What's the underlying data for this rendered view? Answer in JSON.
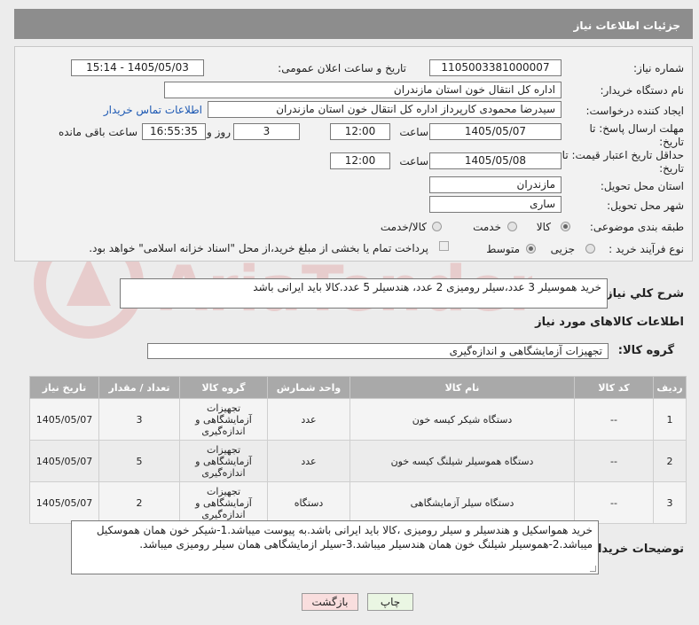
{
  "page": {
    "title": "جزئیات اطلاعات نیاز"
  },
  "form": {
    "need_number_label": "شماره نیاز:",
    "need_number": "1105003381000007",
    "announce_label": "تاریخ و ساعت اعلان عمومی:",
    "announce_value": "1405/05/03 - 15:14",
    "buyer_org_label": "نام دستگاه خریدار:",
    "buyer_org": "اداره کل انتقال خون استان مازندران",
    "creator_label": "ایجاد کننده درخواست:",
    "creator": "سیدرضا محمودی کارپرداز اداره کل انتقال خون استان مازندران",
    "contact_link": "اطلاعات تماس خریدار",
    "send_deadline_label": "مهلت ارسال پاسخ: تا تاریخ:",
    "send_date": "1405/05/07",
    "time_label": "ساعت",
    "send_time": "12:00",
    "days_value": "3",
    "days_label": "روز و",
    "remaining_time": "16:55:35",
    "remaining_label": "ساعت باقی مانده",
    "validity_label": "حداقل تاریخ اعتبار قیمت: تا تاریخ:",
    "validity_date": "1405/05/08",
    "validity_time": "12:00",
    "province_label": "استان محل تحویل:",
    "province": "مازندران",
    "city_label": "شهر محل تحویل:",
    "city": "ساری",
    "category_label": "طبقه بندی موضوعی:",
    "category_options": [
      "کالا",
      "خدمت",
      "کالا/خدمت"
    ],
    "process_label": "نوع فرآیند خرید :",
    "process_options": [
      "جزیی",
      "متوسط"
    ],
    "payment_note": "پرداخت تمام یا بخشی از مبلغ خرید،از محل \"اسناد خزانه اسلامی\" خواهد بود."
  },
  "description": {
    "label": "شرح کلي نياز:",
    "value": "خرید هموسیلر 3 عدد،سیلر رومیزی 2 عدد، هندسیلر 5 عدد.کالا باید ایرانی باشد"
  },
  "goods": {
    "section_title": "اطلاعات کالاهای مورد نیاز",
    "group_label": "گروه کالا:",
    "group_value": "تجهیزات آزمایشگاهی و اندازه‌گیری",
    "columns": [
      "ردیف",
      "کد کالا",
      "نام کالا",
      "واحد شمارش",
      "گروه کالا",
      "تعداد / مقدار",
      "تاریخ نیاز"
    ],
    "rows": [
      {
        "idx": "1",
        "code": "--",
        "name": "دستگاه شیکر کیسه خون",
        "unit": "عدد",
        "group": "تجهیزات آزمایشگاهی و اندازه‌گیری",
        "qty": "3",
        "date": "1405/05/07"
      },
      {
        "idx": "2",
        "code": "--",
        "name": "دستگاه هموسیلر شیلنگ کیسه خون",
        "unit": "عدد",
        "group": "تجهیزات آزمایشگاهی و اندازه‌گیری",
        "qty": "5",
        "date": "1405/05/07"
      },
      {
        "idx": "3",
        "code": "--",
        "name": "دستگاه سیلر آزمایشگاهی",
        "unit": "دستگاه",
        "group": "تجهیزات آزمایشگاهی و اندازه‌گیری",
        "qty": "2",
        "date": "1405/05/07"
      }
    ]
  },
  "buyer_notes": {
    "label": "توضیحات خریدار:",
    "value": "خرید همواسکیل و هندسیلر و سیلر رومیزی ،کالا باید ایرانی باشد.به پیوست میباشد.1-شیکر خون همان هموسکیل میباشد.2-هموسیلر شیلنگ خون همان هندسیلر میباشد.3-سیلر ازمایشگاهی همان سیلر رومیزی میباشد."
  },
  "buttons": {
    "print": "چاپ",
    "back": "بازگشت"
  },
  "colors": {
    "header": "#8d8d8d",
    "table_header": "#a9a9a9",
    "link": "#1c58b3",
    "back_button": "#f9dede",
    "print_button": "#eaf6e3"
  }
}
